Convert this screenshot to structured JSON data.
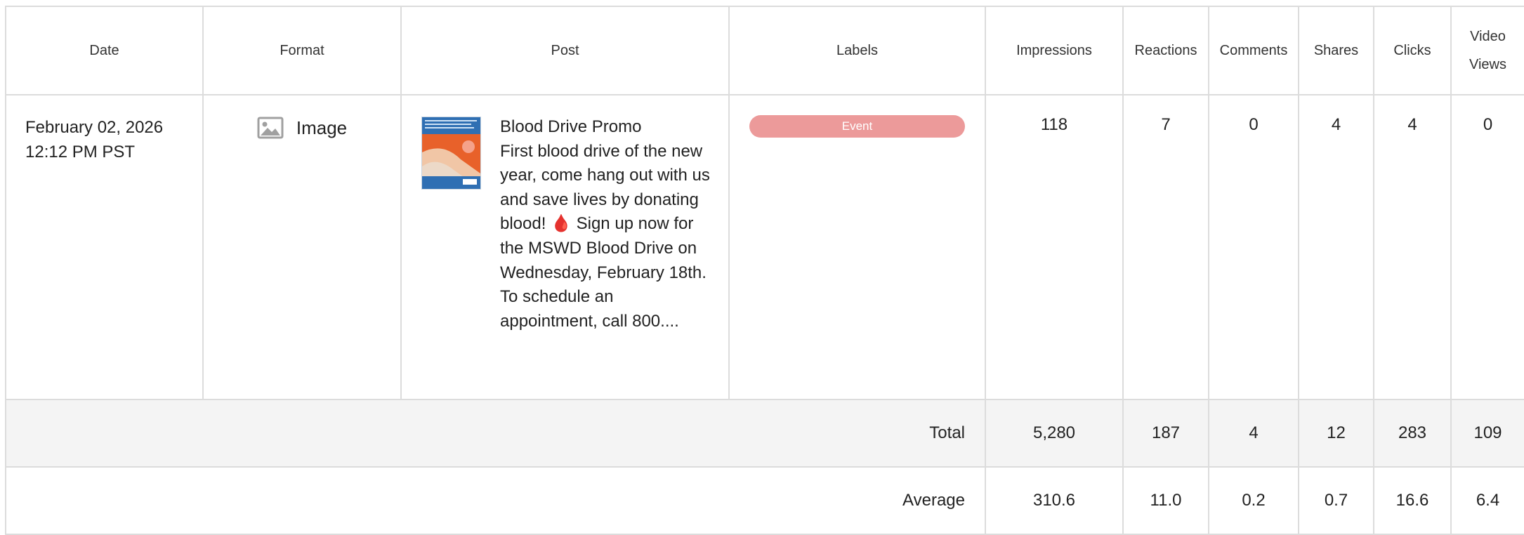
{
  "table": {
    "headers": {
      "date": "Date",
      "format": "Format",
      "post": "Post",
      "labels": "Labels",
      "impressions": "Impressions",
      "reactions": "Reactions",
      "comments": "Comments",
      "shares": "Shares",
      "clicks": "Clicks",
      "video_views_1": "Video",
      "video_views_2": "Views"
    },
    "rows": [
      {
        "date": "February 02, 2026",
        "time": "12:12 PM PST",
        "format": "Image",
        "format_icon": "image-icon",
        "post_title": "Blood Drive Promo",
        "post_body": "First blood drive of the new year, come hang out with us and save lives by donating blood! 🩸 Sign up now for the MSWD Blood Drive on Wednesday, February 18th. To schedule an appointment, call 800....",
        "label": "Event",
        "label_color": "#ec9a9a",
        "impressions": "118",
        "reactions": "7",
        "comments": "0",
        "shares": "4",
        "clicks": "4",
        "video_views": "0"
      }
    ],
    "total": {
      "label": "Total",
      "impressions": "5,280",
      "reactions": "187",
      "comments": "4",
      "shares": "12",
      "clicks": "283",
      "video_views": "109"
    },
    "average": {
      "label": "Average",
      "impressions": "310.6",
      "reactions": "11.0",
      "comments": "0.2",
      "shares": "0.7",
      "clicks": "16.6",
      "video_views": "6.4"
    }
  }
}
